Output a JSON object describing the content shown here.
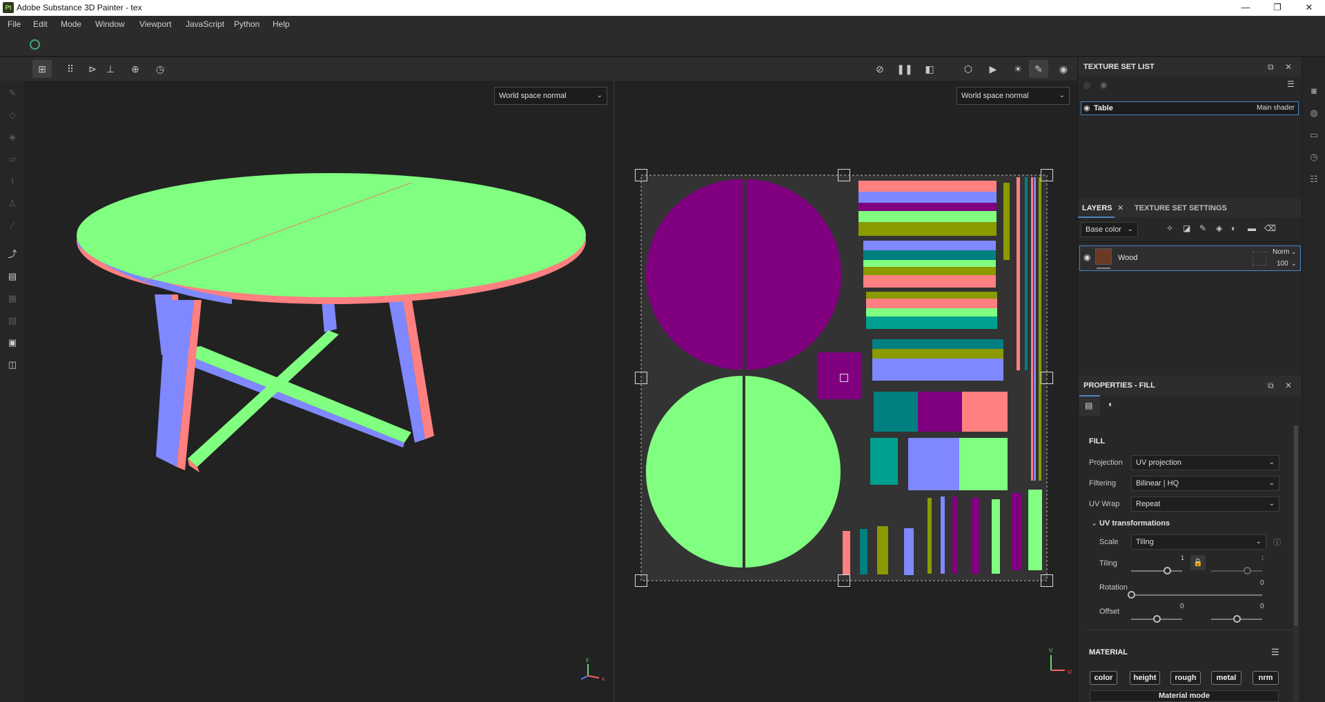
{
  "window": {
    "app_icon": "Pt",
    "title": "Adobe Substance 3D Painter - tex",
    "minimize": "—",
    "maximize": "❐",
    "close": "✕"
  },
  "menu": [
    "File",
    "Edit",
    "Mode",
    "Window",
    "Viewport",
    "JavaScript",
    "Python",
    "Help"
  ],
  "viewport": {
    "left_mode": "World space normal",
    "right_mode": "World space normal",
    "axis_x": "x",
    "axis_y": "y",
    "axis_u": "U",
    "axis_v": "V"
  },
  "texture_set_list": {
    "title": "TEXTURE SET LIST",
    "item_name": "Table",
    "item_shader": "Main shader"
  },
  "layers": {
    "tab_layers": "LAYERS",
    "tab_settings": "TEXTURE SET SETTINGS",
    "channel": "Base color",
    "layer_name": "Wood",
    "blend_mode": "Norm",
    "opacity": "100"
  },
  "properties": {
    "title": "PROPERTIES - FILL",
    "section_fill": "FILL",
    "projection_label": "Projection",
    "projection_value": "UV projection",
    "filtering_label": "Filtering",
    "filtering_value": "Bilinear | HQ",
    "uvwrap_label": "UV Wrap",
    "uvwrap_value": "Repeat",
    "uv_transform_label": "UV transformations",
    "scale_label": "Scale",
    "scale_value": "Tiling",
    "tiling_label": "Tiling",
    "tiling_value_1": "1",
    "tiling_value_2": "1",
    "tiling_level_1": 0.7,
    "tiling_level_2": 0.7,
    "rotation_label": "Rotation",
    "rotation_value": "0",
    "rotation_level": 0.0,
    "offset_label": "Offset",
    "offset_value_1": "0",
    "offset_value_2": "0",
    "offset_level_1": 0.5,
    "offset_level_2": 0.5,
    "section_material": "MATERIAL",
    "chips": [
      "color",
      "height",
      "rough",
      "metal",
      "nrm"
    ],
    "material_mode": "Material mode"
  }
}
